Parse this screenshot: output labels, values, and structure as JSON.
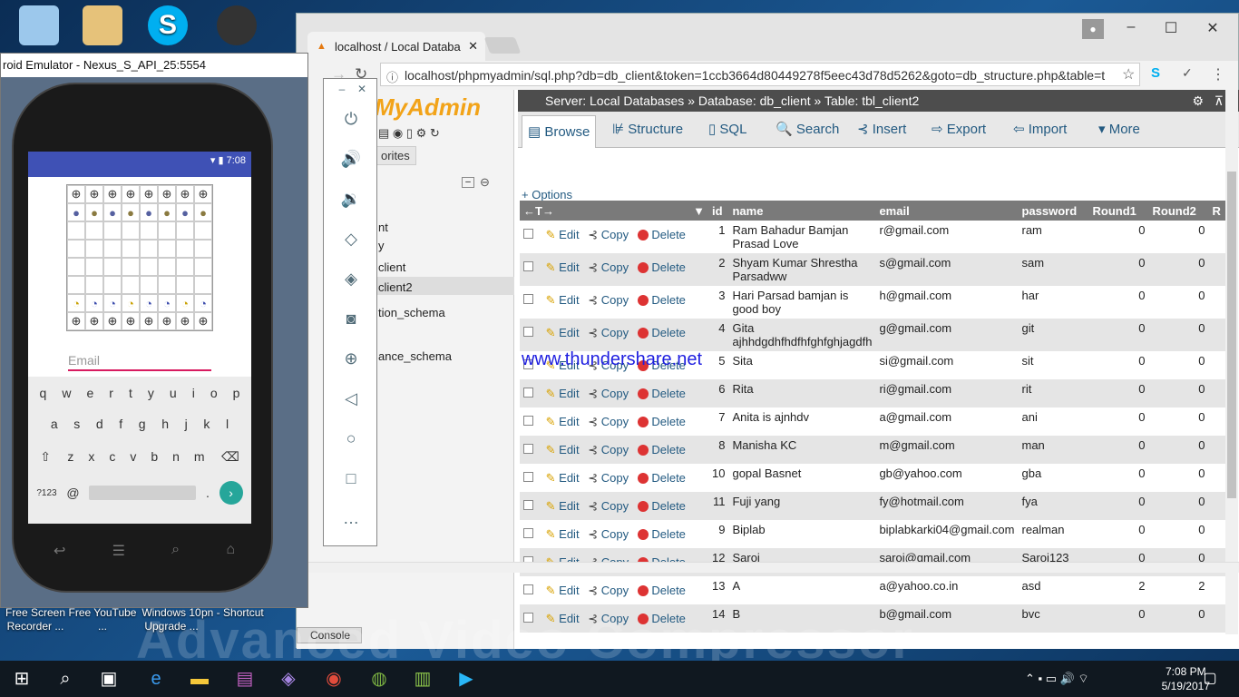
{
  "desktop": {
    "icons": [
      {
        "label": "",
        "icon": "computer-icon"
      },
      {
        "label": "",
        "icon": "diagram-app-icon"
      },
      {
        "label": "",
        "icon": "skype-icon"
      },
      {
        "label": "",
        "icon": "camera-icon"
      },
      {
        "label": "Free Screen Recorder ...",
        "icon": "screen-recorder-icon"
      },
      {
        "label": "Free YouTube ...",
        "icon": "youtube-icon"
      },
      {
        "label": "Windows 10 Upgrade ...",
        "icon": "windows-upgrade-icon"
      },
      {
        "label": "pn - Shortcut",
        "icon": "shortcut-icon"
      }
    ],
    "watermark": "Advanced Video Compressor"
  },
  "emulator": {
    "title": "roid Emulator - Nexus_S_API_25:5554",
    "status_time": "7:08",
    "email_placeholder": "Email",
    "keyboard": {
      "row1": [
        "q",
        "w",
        "e",
        "r",
        "t",
        "y",
        "u",
        "i",
        "o",
        "p"
      ],
      "row2": [
        "a",
        "s",
        "d",
        "f",
        "g",
        "h",
        "j",
        "k",
        "l"
      ],
      "row3": [
        "z",
        "x",
        "c",
        "v",
        "b",
        "n",
        "m"
      ],
      "symbols_key": "?123",
      "at_key": "@",
      "period_key": "."
    }
  },
  "browser": {
    "tab_title": "localhost / Local Databa",
    "url": "localhost/phpmyadmin/sql.php?db=db_client&token=1ccb3664d80449278f5eec43d78d5262&goto=db_structure.php&table=t"
  },
  "pma": {
    "logo": "MyAdmin",
    "favorites": "orites",
    "tree": [
      "nt",
      "y",
      "client",
      "client2",
      "tion_schema",
      "ance_schema"
    ],
    "breadcrumb": {
      "server": "Server: Local Databases",
      "database": "Database: db_client",
      "table": "Table: tbl_client2"
    },
    "menu": [
      "Browse",
      "Structure",
      "SQL",
      "Search",
      "Insert",
      "Export",
      "Import",
      "More"
    ],
    "options": "+ Options",
    "actions": {
      "edit": "Edit",
      "copy": "Copy",
      "delete": "Delete"
    },
    "columns": [
      "id",
      "name",
      "email",
      "password",
      "Round1",
      "Round2",
      "R"
    ],
    "rows": [
      {
        "id": "1",
        "name": "Ram Bahadur Bamjan Prasad Love",
        "email": "r@gmail.com",
        "password": "ram",
        "round1": "0",
        "round2": "0"
      },
      {
        "id": "2",
        "name": "Shyam Kumar Shrestha Parsadww",
        "email": "s@gmail.com",
        "password": "sam",
        "round1": "0",
        "round2": "0"
      },
      {
        "id": "3",
        "name": "Hari Parsad bamjan is good boy",
        "email": "h@gmail.com",
        "password": "har",
        "round1": "0",
        "round2": "0"
      },
      {
        "id": "4",
        "name": "Gita ajhhdgdhfhdfhfghfghjagdfh",
        "email": "g@gmail.com",
        "password": "git",
        "round1": "0",
        "round2": "0"
      },
      {
        "id": "5",
        "name": "Sita",
        "email": "si@gmail.com",
        "password": "sit",
        "round1": "0",
        "round2": "0"
      },
      {
        "id": "6",
        "name": "Rita",
        "email": "ri@gmail.com",
        "password": "rit",
        "round1": "0",
        "round2": "0"
      },
      {
        "id": "7",
        "name": "Anita is ajnhdv",
        "email": "a@gmail.com",
        "password": "ani",
        "round1": "0",
        "round2": "0"
      },
      {
        "id": "8",
        "name": "Manisha KC",
        "email": "m@gmail.com",
        "password": "man",
        "round1": "0",
        "round2": "0"
      },
      {
        "id": "10",
        "name": "gopal Basnet",
        "email": "gb@yahoo.com",
        "password": "gba",
        "round1": "0",
        "round2": "0"
      },
      {
        "id": "11",
        "name": "Fuji yang",
        "email": "fy@hotmail.com",
        "password": "fya",
        "round1": "0",
        "round2": "0"
      },
      {
        "id": "9",
        "name": "Biplab",
        "email": "biplabkarki04@gmail.com",
        "password": "realman",
        "round1": "0",
        "round2": "0"
      },
      {
        "id": "12",
        "name": "Saroj",
        "email": "saroj@gmail.com",
        "password": "Saroj123",
        "round1": "0",
        "round2": "0"
      },
      {
        "id": "13",
        "name": "A",
        "email": "a@yahoo.co.in",
        "password": "asd",
        "round1": "2",
        "round2": "2"
      },
      {
        "id": "14",
        "name": "B",
        "email": "b@gmail.com",
        "password": "bvc",
        "round1": "0",
        "round2": "0"
      }
    ],
    "console": "Console",
    "site_watermark": "www.thundershare.net"
  },
  "taskbar": {
    "time": "7:08 PM",
    "date": "5/19/2017"
  }
}
